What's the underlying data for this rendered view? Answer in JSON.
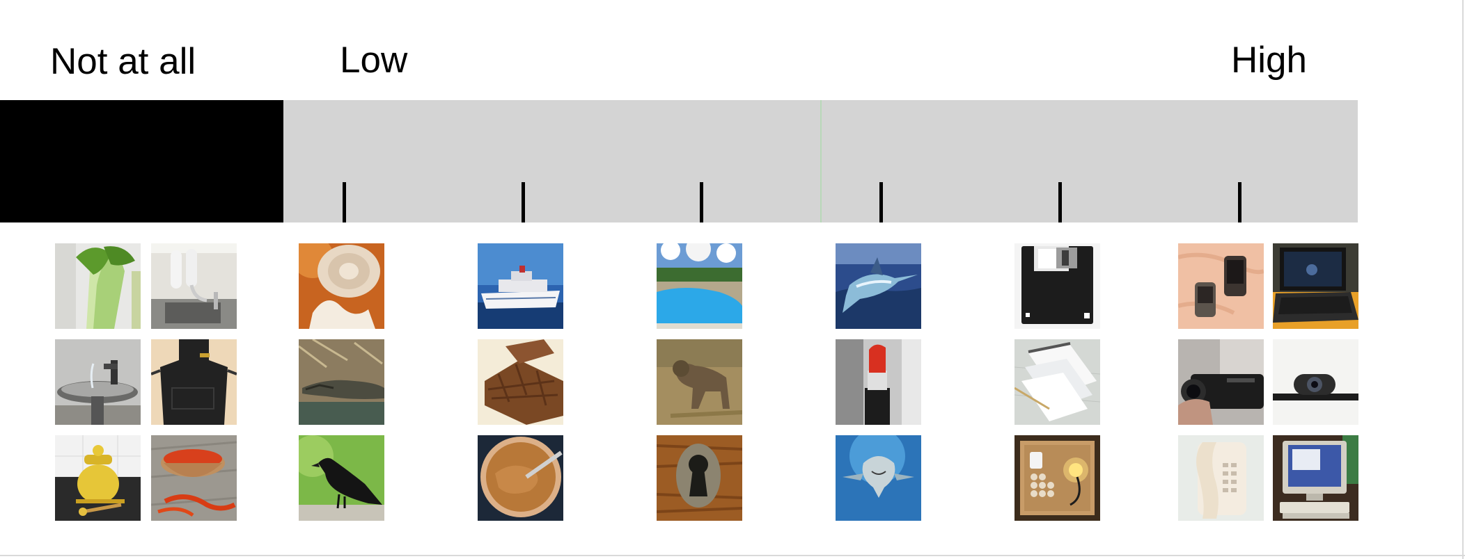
{
  "scale": {
    "labels": {
      "not_at_all": "Not at all",
      "low": "Low",
      "high": "High"
    },
    "tick_count": 6,
    "colors": {
      "not_at_all_band": "#000000",
      "scale_band": "#d4d4d4",
      "midline": "#b8d8b8",
      "tick": "#000000"
    }
  },
  "image_columns": [
    {
      "group": "not-at-all",
      "images": [
        "bok-choy-photo",
        "apron-photo",
        "honey-pot-photo"
      ]
    },
    {
      "group": "not-at-all",
      "images": [
        "water-filter-faucet-photo",
        "drinking-fountain-photo",
        "saffron-bowl-photo"
      ]
    },
    {
      "group": "level-1",
      "images": [
        "baby-ultrasound-model-photo",
        "alligator-photo",
        "crow-photo"
      ]
    },
    {
      "group": "level-2",
      "images": [
        "cruise-ship-photo",
        "chocolate-bar-photo",
        "peanut-butter-jar-photo"
      ]
    },
    {
      "group": "level-3",
      "images": [
        "swimming-pool-photo",
        "hyena-photo",
        "keyhole-photo"
      ]
    },
    {
      "group": "level-4",
      "images": [
        "marlin-photo",
        "lipstick-photo",
        "shark-photo"
      ]
    },
    {
      "group": "level-5",
      "images": [
        "floppy-disk-photo",
        "notepad-photo",
        "electronics-kit-photo"
      ]
    },
    {
      "group": "level-6",
      "images": [
        "mobile-phones-photo",
        "camcorder-photo",
        "wall-telephone-photo"
      ]
    },
    {
      "group": "level-6",
      "images": [
        "laptop-photo",
        "webcam-photo",
        "desktop-computer-photo"
      ]
    }
  ]
}
